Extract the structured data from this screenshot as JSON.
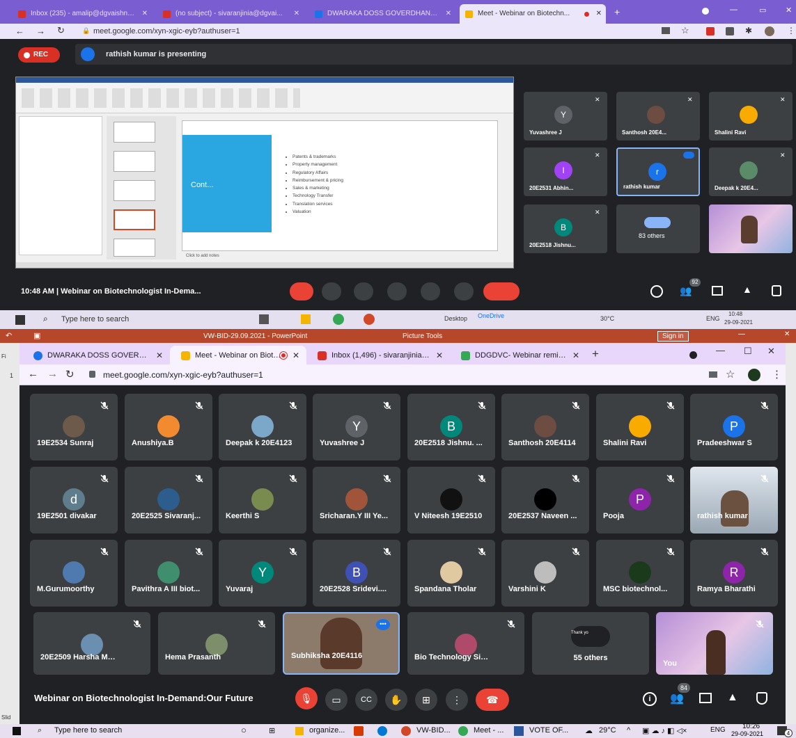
{
  "top": {
    "tabs": [
      {
        "label": "Inbox (235) - amalip@dgvaishnavco...",
        "color": "#d93025"
      },
      {
        "label": "(no subject) - sivaranjinia@dgvai...",
        "color": "#d93025"
      },
      {
        "label": "DWARAKA DOSS GOVERDHAN D...",
        "color": "#1a73e8"
      },
      {
        "label": "Meet - Webinar on Biotechn...",
        "color": "#f4b400"
      }
    ],
    "url": "meet.google.com/xyn-xgic-eyb?authuser=1",
    "rec": "REC",
    "presenting": "rathish kumar is presenting",
    "slide": {
      "title": "Cont...",
      "bullets": [
        "Patents & trademarks",
        "Property management",
        "Regulatory Affairs",
        "Reimbursement & pricing",
        "Sales & marketing",
        "Technology Transfer",
        "Translation services",
        "Valuation"
      ],
      "notes": "Click to add notes"
    },
    "tiles": [
      {
        "name": "Yuvashree J",
        "letter": "Y",
        "color": "#5f6368"
      },
      {
        "name": "Santhosh 20E4...",
        "letter": "",
        "color": "#6d4c41"
      },
      {
        "name": "Shalini Ravi",
        "letter": "",
        "color": "#f9ab00"
      },
      {
        "name": "20E2531 Abhin...",
        "letter": "I",
        "color": "#a142f4"
      },
      {
        "name": "rathish kumar",
        "letter": "r",
        "color": "#1a73e8"
      },
      {
        "name": "Deepak k 20E4...",
        "letter": "",
        "color": "#5b8c6a"
      },
      {
        "name": "20E2518 Jishnu...",
        "letter": "B",
        "color": "#00897b"
      },
      {
        "name": "83 others",
        "letter": "",
        "color": "#5f6368"
      },
      {
        "name": "",
        "letter": "",
        "color": "#c9a0dc"
      }
    ],
    "time_title": "10:48 AM  |  Webinar on Biotechnologist In-Dema...",
    "people_count": "92",
    "taskbar": {
      "search": "Type here to search",
      "temp": "30°C",
      "lang": "ENG",
      "time": "10:48",
      "date": "29-09-2021",
      "desktop": "Desktop",
      "onedrive": "OneDrive"
    }
  },
  "ppt": {
    "filename": "VW-BID-29.09.2021  -  PowerPoint",
    "tools": "Picture Tools",
    "signin": "Sign in",
    "left_labels": [
      "Fi",
      "1",
      "Slid"
    ]
  },
  "bottom": {
    "tabs": [
      {
        "label": "DWARAKA DOSS GOVERDHAN D",
        "color": "#1a73e8"
      },
      {
        "label": "Meet - Webinar on Biotechn",
        "color": "#f4b400"
      },
      {
        "label": "Inbox (1,496) - sivaranjinia@dgva",
        "color": "#d93025"
      },
      {
        "label": "DDGDVC- Webinar reminder- \"B",
        "color": "#34a853"
      }
    ],
    "url": "meet.google.com/xyn-xgic-eyb?authuser=1",
    "tiles": [
      {
        "name": "19E2534 Sunraj",
        "letter": "",
        "color": "#6d5a4a"
      },
      {
        "name": "Anushiya.B",
        "letter": "",
        "color": "#f28b30"
      },
      {
        "name": "Deepak k 20E4123",
        "letter": "",
        "color": "#7ba7c9"
      },
      {
        "name": "Yuvashree J",
        "letter": "Y",
        "color": "#5f6368"
      },
      {
        "name": "20E2518 Jishnu. ...",
        "letter": "B",
        "color": "#00897b"
      },
      {
        "name": "Santhosh 20E4114",
        "letter": "",
        "color": "#6d4c41"
      },
      {
        "name": "Shalini Ravi",
        "letter": "",
        "color": "#f9ab00"
      },
      {
        "name": "Pradeeshwar S",
        "letter": "P",
        "color": "#1a73e8"
      },
      {
        "name": "19E2501 divakar",
        "letter": "d",
        "color": "#607d8b"
      },
      {
        "name": "20E2525 Sivaranj...",
        "letter": "",
        "color": "#2c5d8c"
      },
      {
        "name": "Keerthi S",
        "letter": "",
        "color": "#7a8b4f"
      },
      {
        "name": "Sricharan.Y III Ye...",
        "letter": "",
        "color": "#a0543a"
      },
      {
        "name": "V Niteesh 19E2510",
        "letter": "",
        "color": "#111111"
      },
      {
        "name": "20E2537 Naveen ...",
        "letter": "",
        "color": "#000000"
      },
      {
        "name": "Pooja",
        "letter": "P",
        "color": "#8e24aa"
      },
      {
        "name": "rathish kumar",
        "letter": "",
        "color": "#8aa0b0"
      },
      {
        "name": "M.Gurumoorthy",
        "letter": "",
        "color": "#4f7ab0"
      },
      {
        "name": "Pavithra A III biot...",
        "letter": "",
        "color": "#3f8f6f"
      },
      {
        "name": "Yuvaraj",
        "letter": "Y",
        "color": "#00897b"
      },
      {
        "name": "20E2528 Sridevi....",
        "letter": "B",
        "color": "#3f51b5"
      },
      {
        "name": "Spandana Tholar",
        "letter": "",
        "color": "#e0c8a0"
      },
      {
        "name": "Varshini K",
        "letter": "",
        "color": "#bdbdbd"
      },
      {
        "name": "MSC biotechnol...",
        "letter": "",
        "color": "#1b3a1b"
      },
      {
        "name": "Ramya Bharathi",
        "letter": "R",
        "color": "#8e24aa"
      },
      {
        "name": "20E2509 Harsha M BSc.B...",
        "letter": "",
        "color": "#6a8fb0"
      },
      {
        "name": "Hema Prasanth",
        "letter": "",
        "color": "#7d8f6a"
      },
      {
        "name": "Subhiksha 20E4116",
        "letter": "",
        "color": "#8c7a6a"
      },
      {
        "name": "Bio Technology Sivaranji...",
        "letter": "",
        "color": "#b04a6a"
      },
      {
        "name": "55 others",
        "letter": "",
        "color": "#5f6368"
      },
      {
        "name": "You",
        "letter": "",
        "color": "#c9a0dc"
      }
    ],
    "meeting_title": "Webinar on Biotechnologist In-Demand:Our Future",
    "people_count": "84",
    "others_thumb": "Thank yo",
    "taskbar": {
      "search": "Type here to search",
      "apps": [
        "organize...",
        "VW-BID...",
        "Meet - ...",
        "VOTE OF..."
      ],
      "temp": "29°C",
      "lang": "ENG",
      "time": "10:26",
      "date": "29-09-2021",
      "notif": "4"
    }
  }
}
